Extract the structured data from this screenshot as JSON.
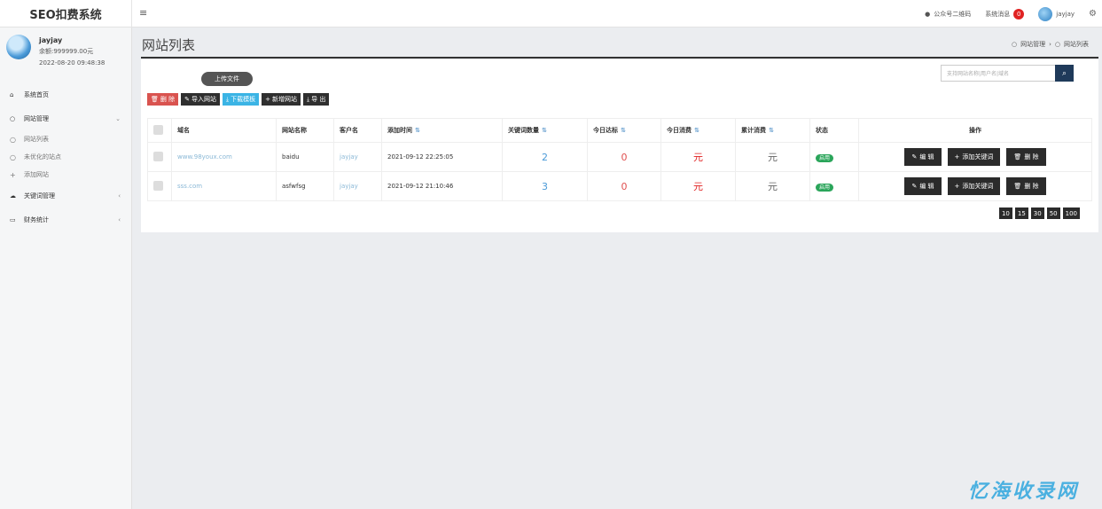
{
  "app": {
    "brand": "SEO扣费系统",
    "menu_toggle": "≡"
  },
  "topbar": {
    "qrcode_label": "公众号二维码",
    "messages_label": "系统消息",
    "messages_count": "0",
    "username": "jayjay"
  },
  "user": {
    "name": "jayjay",
    "balance": "余额:999999.00元",
    "time": "2022-08-20 09:48:38"
  },
  "sidebar": {
    "items": [
      {
        "label": "系统首页",
        "icon": "home-icon"
      },
      {
        "label": "网站管理",
        "icon": "circle-icon",
        "caret": "⌄"
      },
      {
        "label": "网站列表",
        "icon": "circle-icon"
      },
      {
        "label": "未优化的站点",
        "icon": "circle-icon"
      },
      {
        "label": "添加网站",
        "icon": "plus-icon"
      },
      {
        "label": "关键词管理",
        "icon": "cloud-icon",
        "caret": "‹"
      },
      {
        "label": "财务统计",
        "icon": "card-icon",
        "caret": "‹"
      }
    ]
  },
  "page": {
    "title": "网站列表",
    "breadcrumb": [
      "网站管理",
      "网站列表"
    ]
  },
  "toolbar": {
    "upload": "上传文件",
    "delete": "删 除",
    "import": "导入网站",
    "download": "下载模板",
    "add": "新增网站",
    "export": "导 出",
    "search_placeholder": "支持网站名称|用户名|域名"
  },
  "table": {
    "headers": [
      "域名",
      "网站名称",
      "客户名",
      "添加时间",
      "关键词数量",
      "今日达标",
      "今日消费",
      "累计消费",
      "状态",
      "操作"
    ],
    "rows": [
      {
        "domain": "www.98youx.com",
        "site_name": "baidu",
        "customer": "jayjay",
        "added": "2021-09-12 22:25:05",
        "keywords": "2",
        "today_ok": "0",
        "today_cost": "元",
        "total_cost": "元",
        "status": "启用"
      },
      {
        "domain": "sss.com",
        "site_name": "asfwfsg",
        "customer": "jayjay",
        "added": "2021-09-12 21:10:46",
        "keywords": "3",
        "today_ok": "0",
        "today_cost": "元",
        "total_cost": "元",
        "status": "启用"
      }
    ],
    "actions": {
      "edit": "编 辑",
      "add_keyword": "添加关键词",
      "delete": "删 除"
    }
  },
  "pager": [
    "10",
    "15",
    "30",
    "50",
    "100"
  ],
  "watermark": "忆海收录网"
}
